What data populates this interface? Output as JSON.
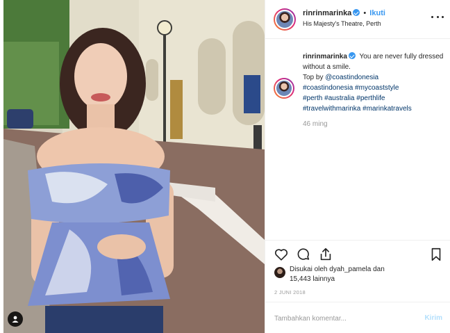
{
  "post": {
    "username": "rinrinmarinka",
    "follow_separator": "•",
    "follow_label": "Ikuti",
    "location": "His Majesty's Theatre, Perth",
    "caption_text": "You are never fully dressed without a smile.",
    "caption_top_by": "Top by ",
    "caption_mention": "@coastindonesia",
    "hashtags_line1": "#coastindonesia #mycoaststyle",
    "hashtags_line2": "#perth #australia #perthlife",
    "hashtags_line3": "#travelwithmarinka #marinkatravels",
    "time_ago": "46 ming",
    "likes_prefix": "Disukai oleh ",
    "likes_user": "dyah_pamela",
    "likes_mid": " dan",
    "likes_count": "15,443 lainnya",
    "date": "2 JUNI 2018"
  },
  "comment": {
    "placeholder": "Tambahkan komentar...",
    "send_label": "Kirim"
  },
  "icons": {
    "like": "heart-icon",
    "comment": "comment-icon",
    "share": "share-icon",
    "save": "bookmark-icon",
    "more": "more-icon",
    "verified": "verified-badge-icon",
    "user_tag": "user-tag-icon"
  },
  "colors": {
    "link": "#3897f0",
    "hashtag": "#003569",
    "muted": "#999999",
    "send_disabled": "#b2dffc"
  }
}
